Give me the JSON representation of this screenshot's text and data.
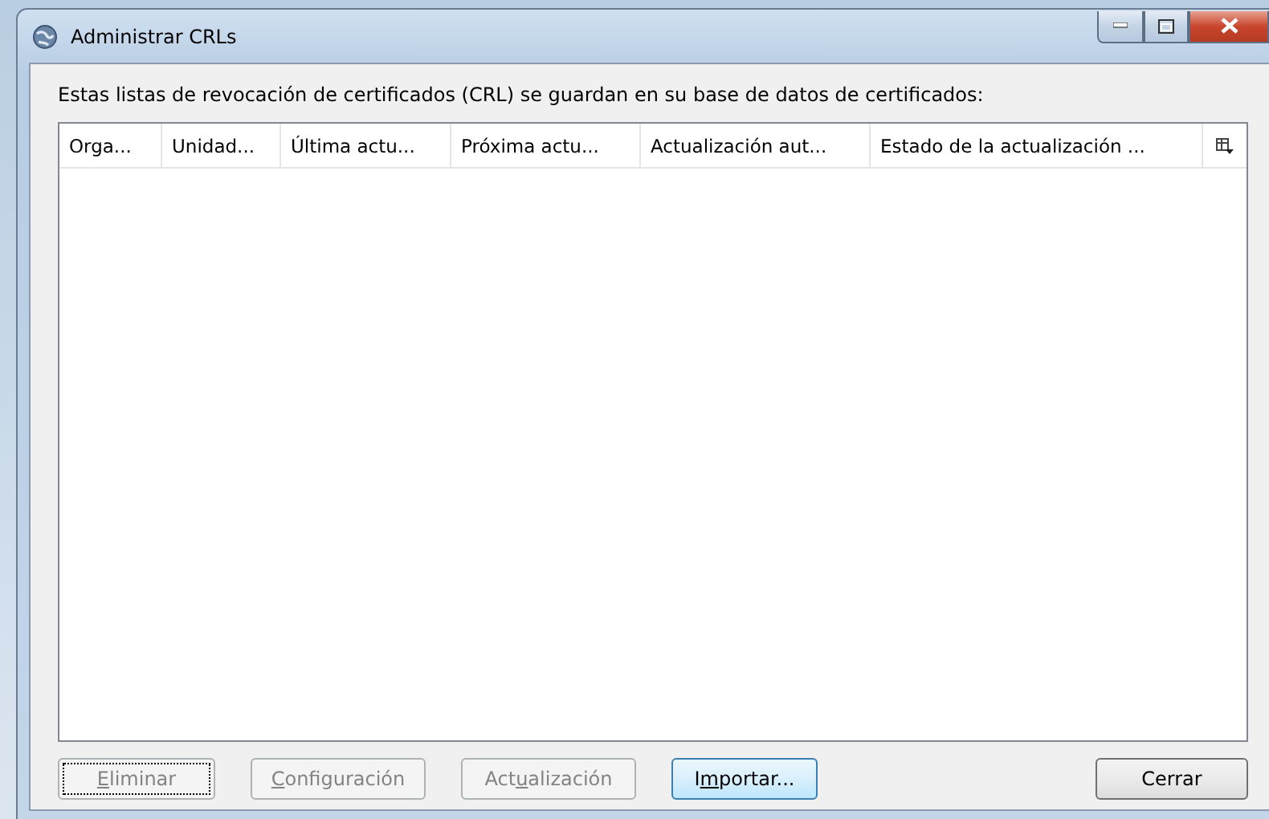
{
  "window": {
    "title": "Administrar CRLs"
  },
  "description": "Estas listas de revocación de certificados (CRL) se guardan en su base de datos de certificados:",
  "table": {
    "columns": [
      {
        "label": "Orga..."
      },
      {
        "label": "Unidad..."
      },
      {
        "label": "Última actu..."
      },
      {
        "label": "Próxima actu..."
      },
      {
        "label": "Actualización aut..."
      },
      {
        "label": "Estado de la actualización ..."
      }
    ]
  },
  "buttons": [
    {
      "label": [
        {
          "text": "E",
          "underlined": true
        },
        {
          "text": "liminar",
          "underlined": false
        }
      ],
      "disabled": true,
      "focused": true,
      "highlighted": false
    },
    {
      "label": [
        {
          "text": "C",
          "underlined": true
        },
        {
          "text": "onfiguración",
          "underlined": false
        }
      ],
      "disabled": true,
      "focused": false,
      "highlighted": false
    },
    {
      "label": [
        {
          "text": "Act",
          "underlined": false
        },
        {
          "text": "u",
          "underlined": true
        },
        {
          "text": "alización",
          "underlined": false
        }
      ],
      "disabled": true,
      "focused": false,
      "highlighted": false
    },
    {
      "label": [
        {
          "text": "I",
          "underlined": false
        },
        {
          "text": "m",
          "underlined": true
        },
        {
          "text": "portar...",
          "underlined": false
        }
      ],
      "disabled": false,
      "focused": false,
      "highlighted": true
    }
  ],
  "close_button": {
    "label": "Cerrar"
  }
}
